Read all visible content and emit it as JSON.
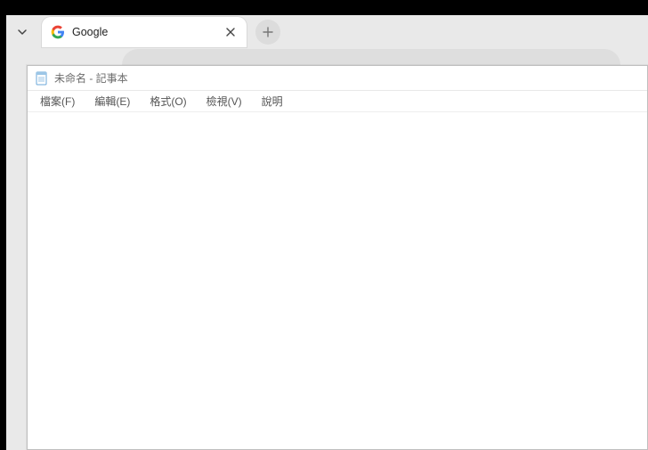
{
  "browser": {
    "tab": {
      "title": "Google"
    }
  },
  "notepad": {
    "title": "未命名 - 記事本",
    "menu": {
      "file": "檔案(F)",
      "edit": "編輯(E)",
      "format": "格式(O)",
      "view": "檢視(V)",
      "help": "說明"
    }
  }
}
